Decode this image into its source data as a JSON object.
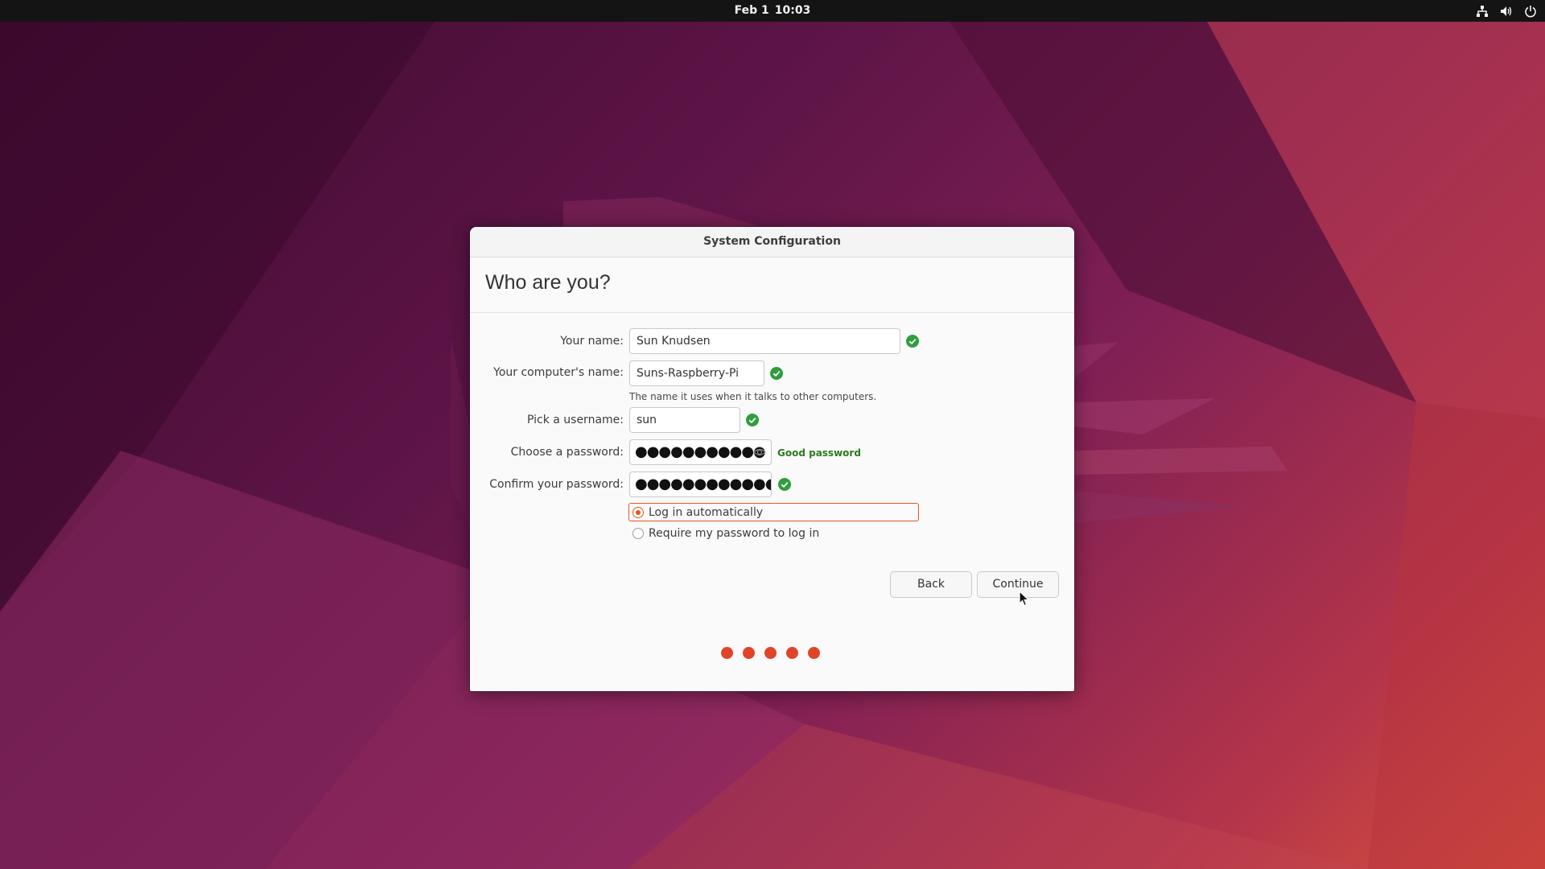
{
  "topbar": {
    "date": "Feb 1",
    "time": "10:03",
    "tray_icons": [
      "network-icon",
      "volume-icon",
      "power-icon"
    ]
  },
  "dialog": {
    "window_title": "System Configuration",
    "page_title": "Who are you?",
    "fields": {
      "name": {
        "label": "Your name:",
        "value": "Sun Knudsen",
        "valid": true
      },
      "computer_name": {
        "label": "Your computer's name:",
        "value": "Suns-Raspberry-Pi",
        "hint": "The name it uses when it talks to other computers.",
        "valid": true
      },
      "username": {
        "label": "Pick a username:",
        "value": "sun",
        "valid": true
      },
      "password": {
        "label": "Choose a password:",
        "masked_value": "●●●●●●●●●●●",
        "strength": "Good password"
      },
      "confirm_password": {
        "label": "Confirm your password:",
        "masked_value": "●●●●●●●●●●●●",
        "valid": true
      }
    },
    "login_options": {
      "auto": {
        "label": "Log in automatically",
        "selected": true
      },
      "require_password": {
        "label": "Require my password to log in",
        "selected": false
      }
    },
    "buttons": {
      "back": "Back",
      "continue": "Continue"
    },
    "progress": {
      "total_steps": 5,
      "completed_steps": 5
    }
  },
  "colors": {
    "accent": "#e95420",
    "valid": "#2e9e3e",
    "strength_text": "#2a7c1c",
    "topbar": "#141414"
  }
}
